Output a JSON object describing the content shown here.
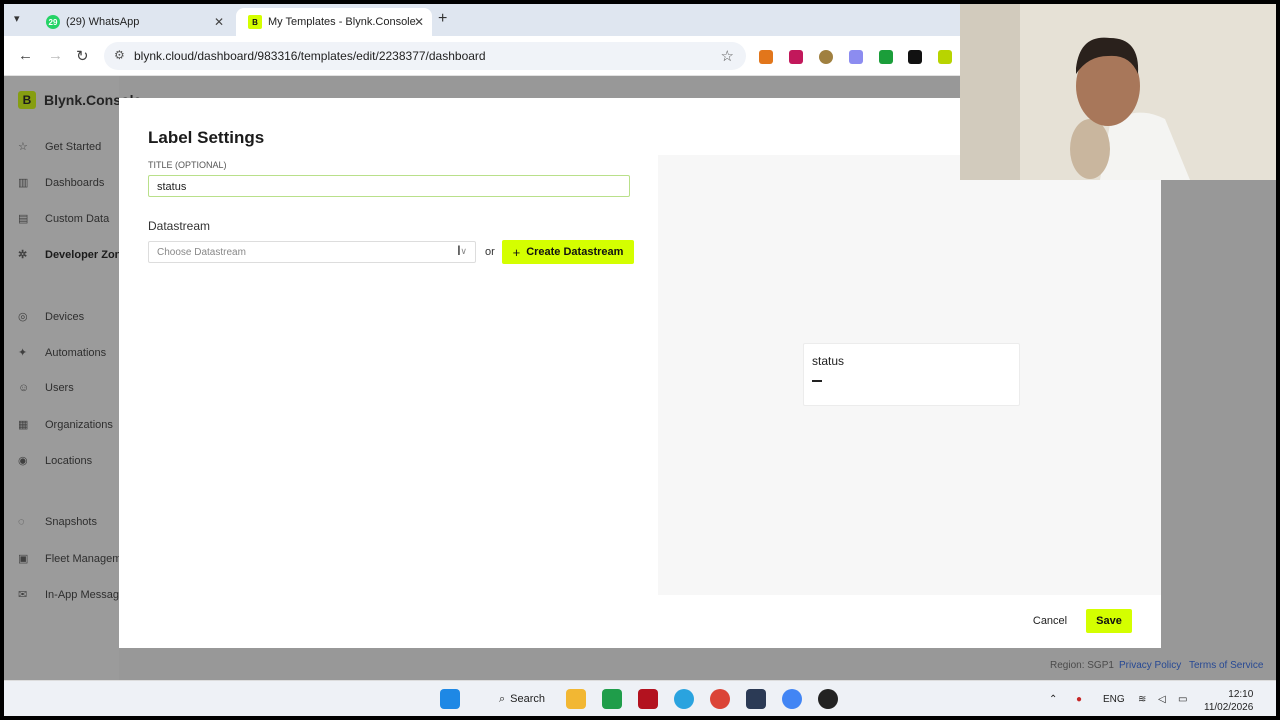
{
  "browser": {
    "tabs": [
      {
        "label": "(29) WhatsApp",
        "badge": "29"
      },
      {
        "label": "My Templates - Blynk.Console"
      }
    ],
    "url": "blynk.cloud/dashboard/983316/templates/edit/2238377/dashboard"
  },
  "sidebar": {
    "brand": "Blynk.Console",
    "items": [
      {
        "label": "Get Started",
        "icon": "star-icon"
      },
      {
        "label": "Dashboards",
        "icon": "chart-icon"
      },
      {
        "label": "Custom Data",
        "icon": "database-icon"
      },
      {
        "label": "Developer Zone",
        "icon": "developer-icon"
      },
      {
        "label": "Devices",
        "icon": "devices-icon"
      },
      {
        "label": "Automations",
        "icon": "automation-icon"
      },
      {
        "label": "Users",
        "icon": "user-icon"
      },
      {
        "label": "Organizations",
        "icon": "organization-icon"
      },
      {
        "label": "Locations",
        "icon": "location-icon"
      },
      {
        "label": "Snapshots",
        "icon": "snapshot-icon"
      },
      {
        "label": "Fleet Managem",
        "icon": "fleet-icon"
      },
      {
        "label": "In-App Messagi",
        "icon": "message-icon"
      }
    ]
  },
  "footer": {
    "region": "Region: SGP1",
    "privacy": "Privacy Policy",
    "terms": "Terms of Service"
  },
  "modal": {
    "title": "Label Settings",
    "title_field_label": "TITLE (OPTIONAL)",
    "title_value": "status",
    "datastream_label": "Datastream",
    "datastream_placeholder": "Choose Datastream",
    "or_text": "or",
    "create_button": "Create Datastream",
    "preview": {
      "title": "status",
      "value": "–"
    },
    "cancel": "Cancel",
    "save": "Save"
  },
  "taskbar": {
    "search_label": "Search",
    "language": "ENG",
    "time": "12:10",
    "date": "11/02/2026"
  },
  "colors": {
    "accent": "#d4ff00",
    "link": "#2563eb"
  }
}
